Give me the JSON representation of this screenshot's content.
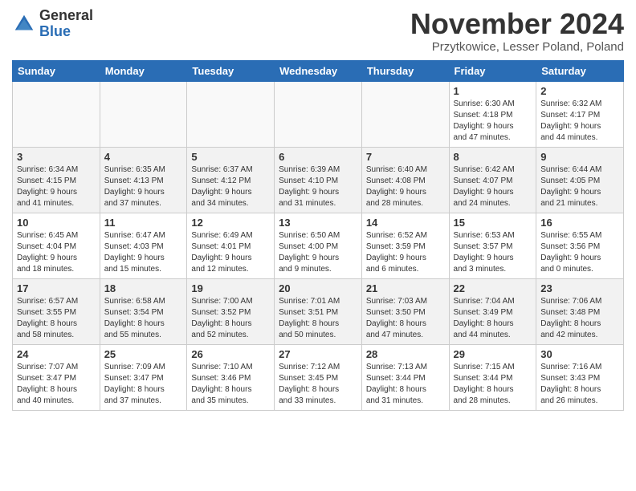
{
  "logo": {
    "general": "General",
    "blue": "Blue"
  },
  "title": "November 2024",
  "subtitle": "Przytkowice, Lesser Poland, Poland",
  "headers": [
    "Sunday",
    "Monday",
    "Tuesday",
    "Wednesday",
    "Thursday",
    "Friday",
    "Saturday"
  ],
  "weeks": [
    [
      {
        "day": "",
        "info": ""
      },
      {
        "day": "",
        "info": ""
      },
      {
        "day": "",
        "info": ""
      },
      {
        "day": "",
        "info": ""
      },
      {
        "day": "",
        "info": ""
      },
      {
        "day": "1",
        "info": "Sunrise: 6:30 AM\nSunset: 4:18 PM\nDaylight: 9 hours\nand 47 minutes."
      },
      {
        "day": "2",
        "info": "Sunrise: 6:32 AM\nSunset: 4:17 PM\nDaylight: 9 hours\nand 44 minutes."
      }
    ],
    [
      {
        "day": "3",
        "info": "Sunrise: 6:34 AM\nSunset: 4:15 PM\nDaylight: 9 hours\nand 41 minutes."
      },
      {
        "day": "4",
        "info": "Sunrise: 6:35 AM\nSunset: 4:13 PM\nDaylight: 9 hours\nand 37 minutes."
      },
      {
        "day": "5",
        "info": "Sunrise: 6:37 AM\nSunset: 4:12 PM\nDaylight: 9 hours\nand 34 minutes."
      },
      {
        "day": "6",
        "info": "Sunrise: 6:39 AM\nSunset: 4:10 PM\nDaylight: 9 hours\nand 31 minutes."
      },
      {
        "day": "7",
        "info": "Sunrise: 6:40 AM\nSunset: 4:08 PM\nDaylight: 9 hours\nand 28 minutes."
      },
      {
        "day": "8",
        "info": "Sunrise: 6:42 AM\nSunset: 4:07 PM\nDaylight: 9 hours\nand 24 minutes."
      },
      {
        "day": "9",
        "info": "Sunrise: 6:44 AM\nSunset: 4:05 PM\nDaylight: 9 hours\nand 21 minutes."
      }
    ],
    [
      {
        "day": "10",
        "info": "Sunrise: 6:45 AM\nSunset: 4:04 PM\nDaylight: 9 hours\nand 18 minutes."
      },
      {
        "day": "11",
        "info": "Sunrise: 6:47 AM\nSunset: 4:03 PM\nDaylight: 9 hours\nand 15 minutes."
      },
      {
        "day": "12",
        "info": "Sunrise: 6:49 AM\nSunset: 4:01 PM\nDaylight: 9 hours\nand 12 minutes."
      },
      {
        "day": "13",
        "info": "Sunrise: 6:50 AM\nSunset: 4:00 PM\nDaylight: 9 hours\nand 9 minutes."
      },
      {
        "day": "14",
        "info": "Sunrise: 6:52 AM\nSunset: 3:59 PM\nDaylight: 9 hours\nand 6 minutes."
      },
      {
        "day": "15",
        "info": "Sunrise: 6:53 AM\nSunset: 3:57 PM\nDaylight: 9 hours\nand 3 minutes."
      },
      {
        "day": "16",
        "info": "Sunrise: 6:55 AM\nSunset: 3:56 PM\nDaylight: 9 hours\nand 0 minutes."
      }
    ],
    [
      {
        "day": "17",
        "info": "Sunrise: 6:57 AM\nSunset: 3:55 PM\nDaylight: 8 hours\nand 58 minutes."
      },
      {
        "day": "18",
        "info": "Sunrise: 6:58 AM\nSunset: 3:54 PM\nDaylight: 8 hours\nand 55 minutes."
      },
      {
        "day": "19",
        "info": "Sunrise: 7:00 AM\nSunset: 3:52 PM\nDaylight: 8 hours\nand 52 minutes."
      },
      {
        "day": "20",
        "info": "Sunrise: 7:01 AM\nSunset: 3:51 PM\nDaylight: 8 hours\nand 50 minutes."
      },
      {
        "day": "21",
        "info": "Sunrise: 7:03 AM\nSunset: 3:50 PM\nDaylight: 8 hours\nand 47 minutes."
      },
      {
        "day": "22",
        "info": "Sunrise: 7:04 AM\nSunset: 3:49 PM\nDaylight: 8 hours\nand 44 minutes."
      },
      {
        "day": "23",
        "info": "Sunrise: 7:06 AM\nSunset: 3:48 PM\nDaylight: 8 hours\nand 42 minutes."
      }
    ],
    [
      {
        "day": "24",
        "info": "Sunrise: 7:07 AM\nSunset: 3:47 PM\nDaylight: 8 hours\nand 40 minutes."
      },
      {
        "day": "25",
        "info": "Sunrise: 7:09 AM\nSunset: 3:47 PM\nDaylight: 8 hours\nand 37 minutes."
      },
      {
        "day": "26",
        "info": "Sunrise: 7:10 AM\nSunset: 3:46 PM\nDaylight: 8 hours\nand 35 minutes."
      },
      {
        "day": "27",
        "info": "Sunrise: 7:12 AM\nSunset: 3:45 PM\nDaylight: 8 hours\nand 33 minutes."
      },
      {
        "day": "28",
        "info": "Sunrise: 7:13 AM\nSunset: 3:44 PM\nDaylight: 8 hours\nand 31 minutes."
      },
      {
        "day": "29",
        "info": "Sunrise: 7:15 AM\nSunset: 3:44 PM\nDaylight: 8 hours\nand 28 minutes."
      },
      {
        "day": "30",
        "info": "Sunrise: 7:16 AM\nSunset: 3:43 PM\nDaylight: 8 hours\nand 26 minutes."
      }
    ]
  ]
}
